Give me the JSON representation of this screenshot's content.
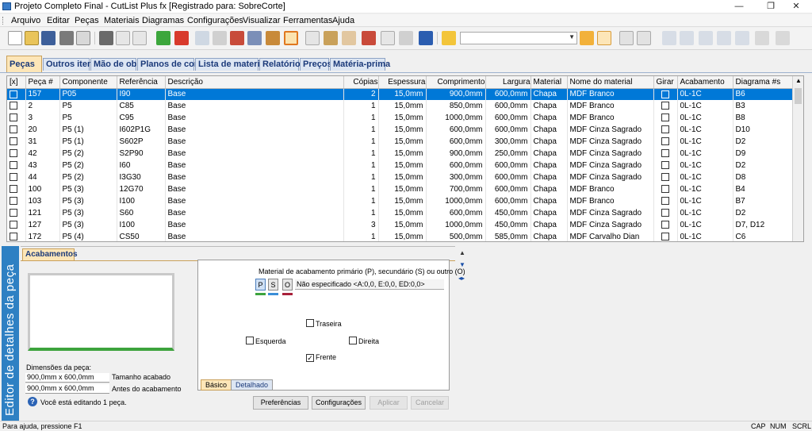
{
  "window": {
    "title": "Projeto Completo Final - CutList Plus fx [Registrado para: SobreCorte]",
    "min": "—",
    "max": "❐",
    "close": "✕"
  },
  "menu": [
    "Arquivo",
    "Editar",
    "Peças",
    "Materiais",
    "Diagramas",
    "Configurações",
    "Visualizar",
    "Ferramentas",
    "Ajuda"
  ],
  "tabs": [
    "Peças",
    "Outros itens",
    "Mão de obra",
    "Planos de corte",
    "Lista de materiais",
    "Relatórios",
    "Preços",
    "Matéria-prima"
  ],
  "grid": {
    "headers": [
      "[x]",
      "Peça #",
      "Componente",
      "Referência",
      "Descrição",
      "Cópias",
      "Espessura",
      "Comprimento",
      "Largura",
      "Material",
      "Nome do material",
      "Girar",
      "Acabamento",
      "Diagrama #s"
    ],
    "rows": [
      [
        "157",
        "P05",
        "I90",
        "Base",
        "2",
        "15,0mm",
        "900,0mm",
        "600,0mm",
        "Chapa",
        "MDF Branco",
        "0L-1C",
        "B6"
      ],
      [
        "2",
        "P5",
        "C85",
        "Base",
        "1",
        "15,0mm",
        "850,0mm",
        "600,0mm",
        "Chapa",
        "MDF Branco",
        "0L-1C",
        "B3"
      ],
      [
        "3",
        "P5",
        "C95",
        "Base",
        "1",
        "15,0mm",
        "1000,0mm",
        "600,0mm",
        "Chapa",
        "MDF Branco",
        "0L-1C",
        "B8"
      ],
      [
        "20",
        "P5 (1)",
        "I602P1G",
        "Base",
        "1",
        "15,0mm",
        "600,0mm",
        "600,0mm",
        "Chapa",
        "MDF Cinza Sagrado",
        "0L-1C",
        "D10"
      ],
      [
        "31",
        "P5 (1)",
        "S602P",
        "Base",
        "1",
        "15,0mm",
        "600,0mm",
        "300,0mm",
        "Chapa",
        "MDF Cinza Sagrado",
        "0L-1C",
        "D2"
      ],
      [
        "42",
        "P5 (2)",
        "S2P90",
        "Base",
        "1",
        "15,0mm",
        "900,0mm",
        "250,0mm",
        "Chapa",
        "MDF Cinza Sagrado",
        "0L-1C",
        "D9"
      ],
      [
        "43",
        "P5 (2)",
        "I60",
        "Base",
        "1",
        "15,0mm",
        "600,0mm",
        "600,0mm",
        "Chapa",
        "MDF Cinza Sagrado",
        "0L-1C",
        "D2"
      ],
      [
        "44",
        "P5 (2)",
        "I3G30",
        "Base",
        "1",
        "15,0mm",
        "300,0mm",
        "600,0mm",
        "Chapa",
        "MDF Cinza Sagrado",
        "0L-1C",
        "D8"
      ],
      [
        "100",
        "P5 (3)",
        "12G70",
        "Base",
        "1",
        "15,0mm",
        "700,0mm",
        "600,0mm",
        "Chapa",
        "MDF Branco",
        "0L-1C",
        "B4"
      ],
      [
        "103",
        "P5 (3)",
        "I100",
        "Base",
        "1",
        "15,0mm",
        "1000,0mm",
        "600,0mm",
        "Chapa",
        "MDF Branco",
        "0L-1C",
        "B7"
      ],
      [
        "121",
        "P5 (3)",
        "S60",
        "Base",
        "1",
        "15,0mm",
        "600,0mm",
        "450,0mm",
        "Chapa",
        "MDF Cinza Sagrado",
        "0L-1C",
        "D2"
      ],
      [
        "127",
        "P5 (3)",
        "I100",
        "Base",
        "3",
        "15,0mm",
        "1000,0mm",
        "450,0mm",
        "Chapa",
        "MDF Cinza Sagrado",
        "0L-1C",
        "D7, D12"
      ],
      [
        "172",
        "P5 (4)",
        "CS50",
        "Base",
        "1",
        "15,0mm",
        "500,0mm",
        "585,0mm",
        "Chapa",
        "MDF Carvalho Dian",
        "0L-1C",
        "C6"
      ]
    ]
  },
  "detail": {
    "side_title": "Editor de detalhes da peça",
    "tab": "Acabamentos",
    "dims_label": "Dimensões da peça:",
    "dim1": "900,0mm x 600,0mm",
    "dim1_label": "Tamanho acabado",
    "dim2": "900,0mm x 600,0mm",
    "dim2_label": "Antes do acabamento",
    "info": "Você está editando 1 peça.",
    "material_title": "Material de acabamento primário (P), secundário (S) ou outro (O)",
    "p": "P",
    "s": "S",
    "o": "O",
    "material_value": "Não especificado <A:0,0, E:0,0, ED:0,0>",
    "traseira": "Traseira",
    "esquerda": "Esquerda",
    "direita": "Direita",
    "frente": "Frente",
    "frente_mark": "✓",
    "tab_basico": "Básico",
    "tab_detalhado": "Detalhado",
    "btn_pref": "Preferências",
    "btn_config": "Configurações",
    "btn_aplicar": "Aplicar",
    "btn_cancelar": "Cancelar"
  },
  "status": {
    "help": "Para ajuda, pressione F1",
    "cap": "CAP",
    "num": "NUM",
    "scrl": "SCRL"
  },
  "colors": {
    "selection": "#0078d7",
    "sidebar": "#2e80c3",
    "active_tab": "#fde6b8",
    "edge_front": "#3da33d"
  }
}
